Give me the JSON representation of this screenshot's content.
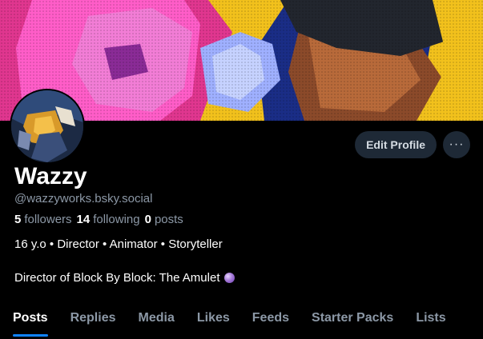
{
  "profile": {
    "display_name": "Wazzy",
    "handle": "@wazzyworks.bsky.social",
    "followers_count": "5",
    "followers_label": "followers",
    "following_count": "14",
    "following_label": "following",
    "posts_count": "0",
    "posts_label": "posts",
    "bio_line1": "16 y.o • Director • Animator • Storyteller",
    "bio_line2": "Director of Block By Block: The Amulet"
  },
  "actions": {
    "edit_label": "Edit Profile",
    "more_label": "···"
  },
  "tabs": [
    {
      "label": "Posts",
      "active": true
    },
    {
      "label": "Replies"
    },
    {
      "label": "Media"
    },
    {
      "label": "Likes"
    },
    {
      "label": "Feeds"
    },
    {
      "label": "Starter Packs"
    },
    {
      "label": "Lists"
    }
  ],
  "colors": {
    "background": "#000000",
    "accent": "#1083fe",
    "muted": "#8c98a6",
    "button_bg": "#1e2936"
  },
  "icons": {
    "more": "ellipsis-icon",
    "emoji": "crystal-ball-icon"
  }
}
